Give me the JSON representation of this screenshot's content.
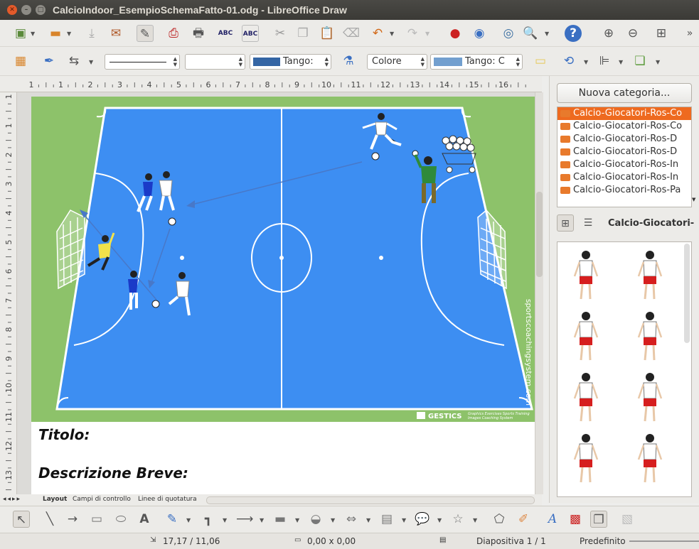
{
  "window": {
    "title": "CalcioIndoor_EsempioSchemaFatto-01.odg - LibreOffice Draw"
  },
  "toolbar": {
    "line_style": "",
    "line_width": "",
    "fill_color_name": "Tango:",
    "fill_type": "Colore",
    "fill_color2_name": "Tango: C",
    "line_color": "#3465a4",
    "fill_color": "#729fcf"
  },
  "ruler": {
    "h_numbers": [
      "1",
      "1",
      "2",
      "3",
      "4",
      "5",
      "6",
      "7",
      "8",
      "9",
      "10",
      "11",
      "12",
      "13",
      "14",
      "15",
      "16"
    ],
    "v_numbers": [
      "1",
      "1",
      "2",
      "3",
      "4",
      "5",
      "6",
      "7",
      "8",
      "9",
      "10",
      "11",
      "12",
      "13"
    ]
  },
  "slide": {
    "watermark": "sportscoachingsystem.com",
    "logo_text": "GESTICS",
    "logo_sub1": "Graphics Exercises Sports Training",
    "logo_sub2": "Images Coaching System",
    "heading_title": "Titolo:",
    "heading_desc": "Descrizione Breve:"
  },
  "sheet_tabs": [
    "Layout",
    "Campi di controllo",
    "Linee di quotatura"
  ],
  "sidebar": {
    "new_category": "Nuova categoria...",
    "categories": [
      "Calcio-Giocatori-Ros-Co",
      "Calcio-Giocatori-Ros-Co",
      "Calcio-Giocatori-Ros-D",
      "Calcio-Giocatori-Ros-D",
      "Calcio-Giocatori-Ros-In",
      "Calcio-Giocatori-Ros-In",
      "Calcio-Giocatori-Ros-Pa"
    ],
    "selected_index": 0,
    "gallery_title": "Calcio-Giocatori-"
  },
  "status": {
    "position": "17,17 / 11,06",
    "size": "0,00 x 0,00",
    "slide": "Diapositiva 1 / 1",
    "layout": "Predefinito"
  }
}
